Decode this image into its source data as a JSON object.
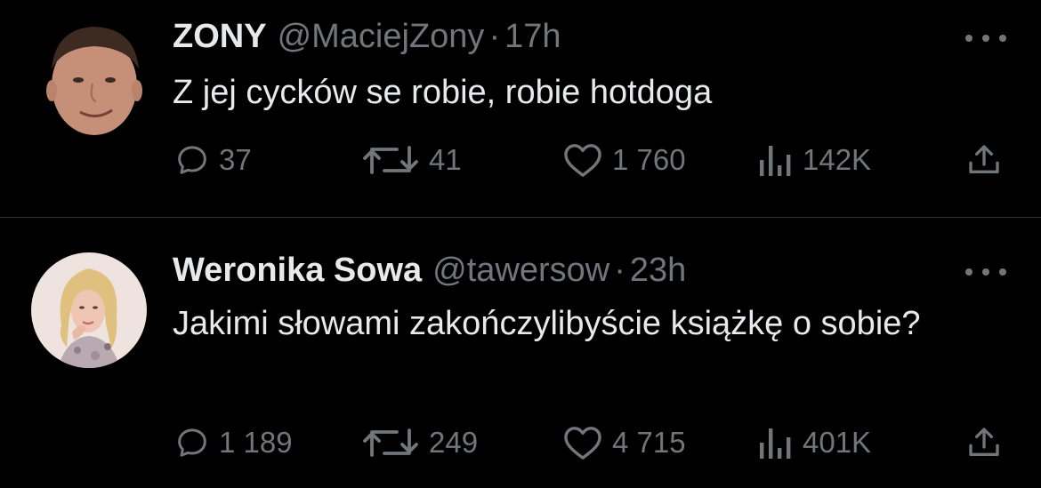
{
  "tweets": [
    {
      "display_name": "ZONY",
      "handle": "@MaciejZony",
      "separator": "·",
      "time": "17h",
      "text": "Z jej cycków se robie, robie hotdoga",
      "replies": "37",
      "reposts": "41",
      "likes": "1 760",
      "views": "142K",
      "avatar_icon": "male-profile-photo"
    },
    {
      "display_name": "Weronika Sowa",
      "handle": "@tawersow",
      "separator": "·",
      "time": "23h",
      "text": "Jakimi słowami zakończylibyście książkę o sobie?",
      "replies": "1 189",
      "reposts": "249",
      "likes": "4 715",
      "views": "401K",
      "avatar_icon": "female-profile-photo"
    }
  ],
  "icons": {
    "reply": "reply-bubble-icon",
    "repost": "repost-arrows-icon",
    "like": "heart-icon",
    "views": "views-bar-chart-icon",
    "share": "share-upload-icon",
    "more": "more-dots-icon"
  },
  "colors": {
    "background": "#000000",
    "primary_text": "#e7e9ea",
    "secondary_text": "#71767b",
    "divider": "#2f3336"
  }
}
